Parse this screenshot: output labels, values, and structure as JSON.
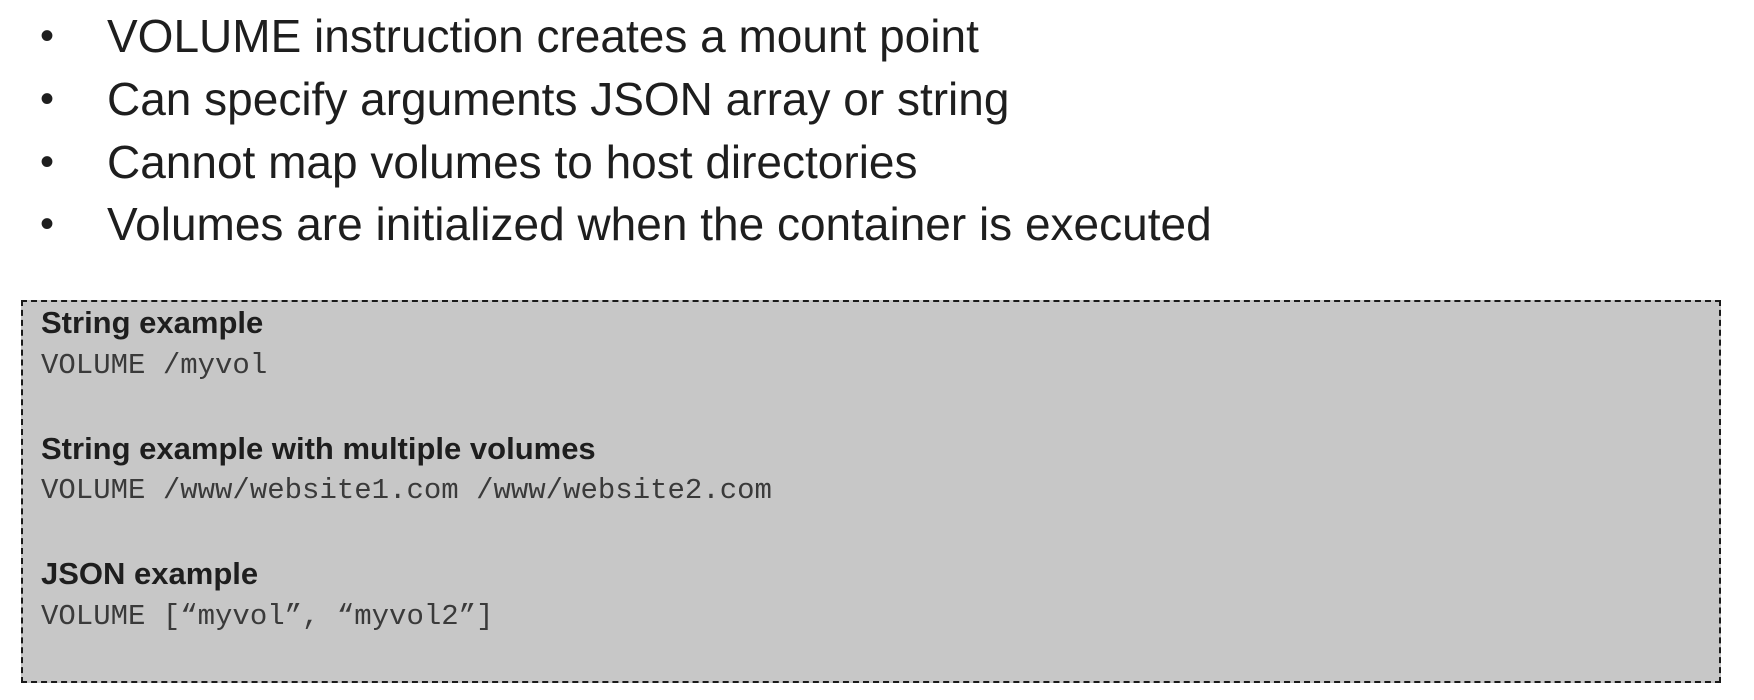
{
  "bullets": [
    {
      "marker": "•",
      "text": "VOLUME instruction creates a mount point"
    },
    {
      "marker": "•",
      "text": "Can specify arguments JSON array or string"
    },
    {
      "marker": "•",
      "text": "Cannot map volumes to host directories"
    },
    {
      "marker": "•",
      "text": "Volumes are initialized when the container is executed"
    }
  ],
  "examples": [
    {
      "heading": "String example",
      "code": "VOLUME /myvol"
    },
    {
      "heading": "String example with multiple volumes",
      "code": "VOLUME /www/website1.com /www/website2.com"
    },
    {
      "heading": "JSON example",
      "code": "VOLUME [“myvol”, “myvol2”]"
    }
  ],
  "colors": {
    "text": "#1e1e1e",
    "box_background": "#c7c7c7",
    "box_border": "#1a1a1a",
    "code_text": "#3a3a3a"
  }
}
